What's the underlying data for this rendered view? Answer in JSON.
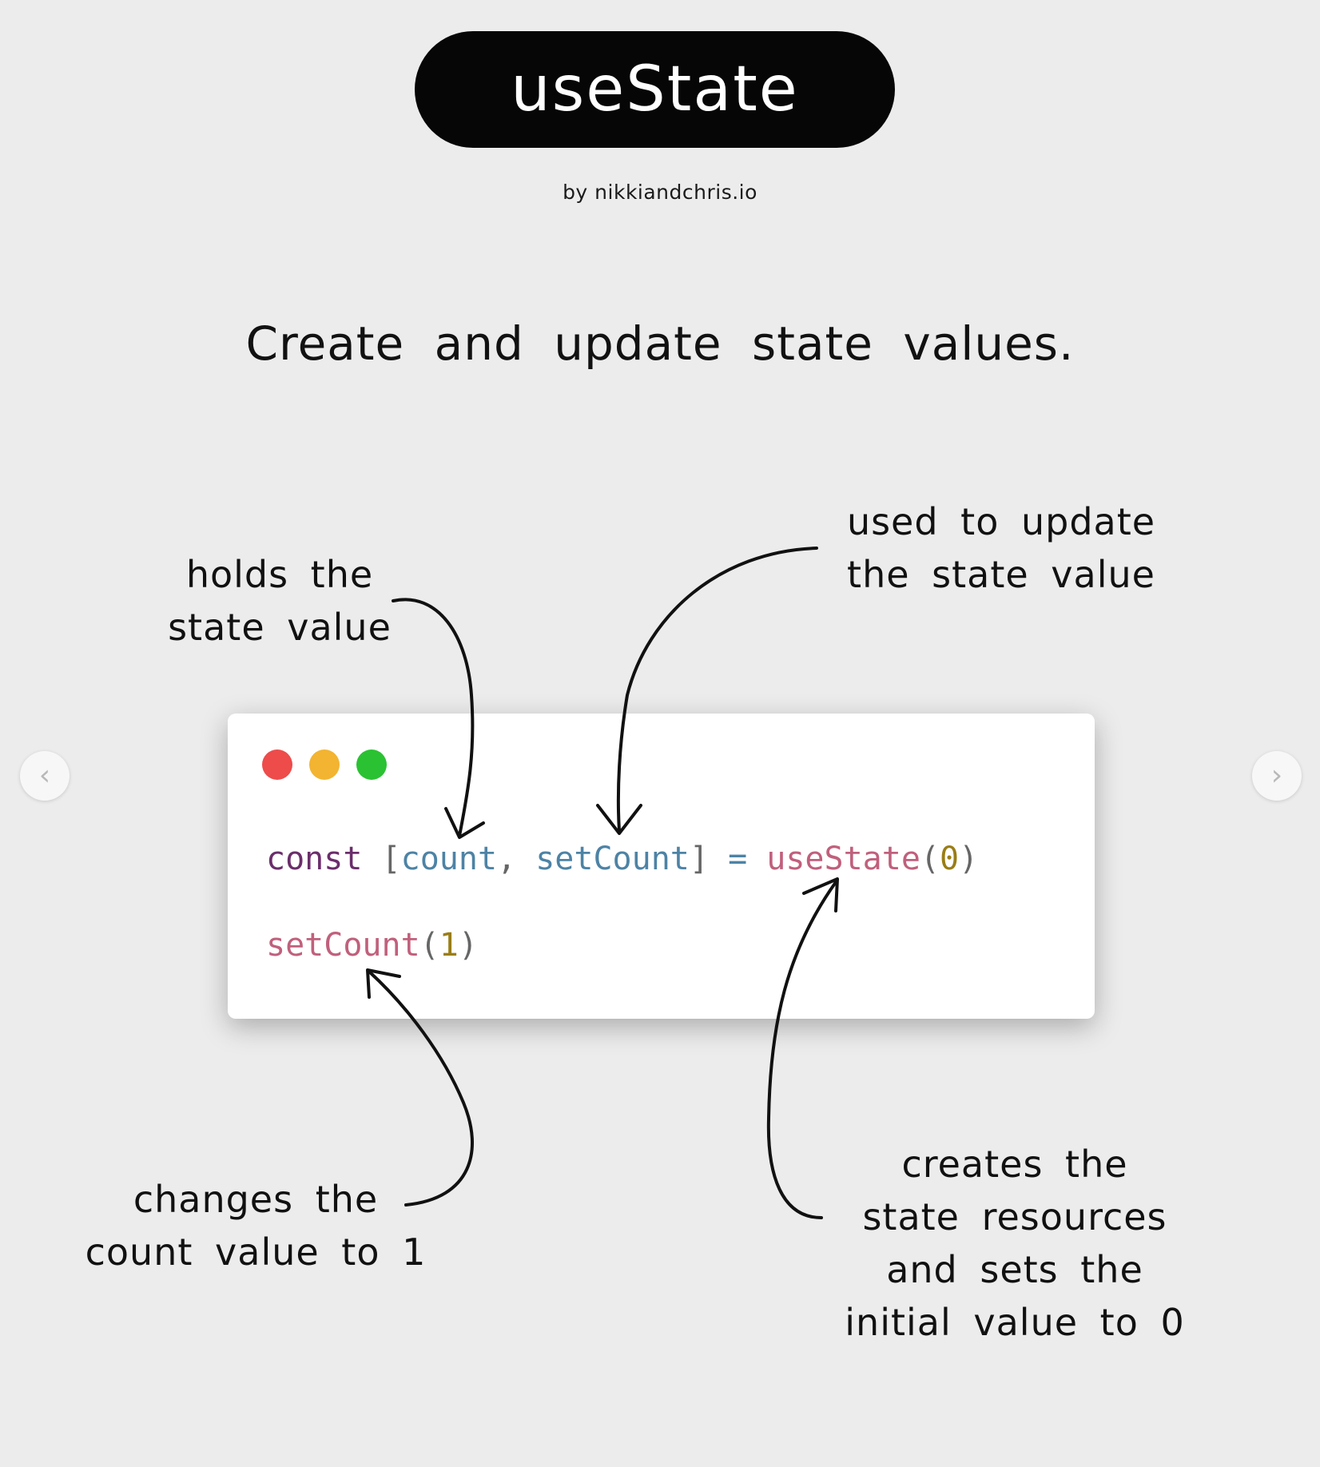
{
  "header": {
    "title": "useState",
    "byline": "by nikkiandchris.io"
  },
  "subtitle": "Create and update state values.",
  "annotations": {
    "holds": [
      "holds the",
      "state value"
    ],
    "used": [
      "used to update",
      "the state value"
    ],
    "changes": [
      "changes the",
      "count value to 1"
    ],
    "creates": [
      "creates the",
      "state resources",
      "and sets the",
      "initial value to 0"
    ]
  },
  "code": {
    "line1": {
      "keyword": "const",
      "open_bracket": "[",
      "var1": "count",
      "comma": ",",
      "var2": "setCount",
      "close_bracket": "]",
      "equals": "=",
      "func": "useState",
      "open_paren": "(",
      "arg": "0",
      "close_paren": ")"
    },
    "line2": {
      "func": "setCount",
      "open_paren": "(",
      "arg": "1",
      "close_paren": ")"
    }
  },
  "window_dots": {
    "red": "#ee4b4b",
    "yellow": "#f2b431",
    "green": "#2ac232"
  },
  "navigation": {
    "prev_icon": "chevron-left-icon",
    "next_icon": "chevron-right-icon",
    "prev_glyph": "‹",
    "next_glyph": "›"
  }
}
